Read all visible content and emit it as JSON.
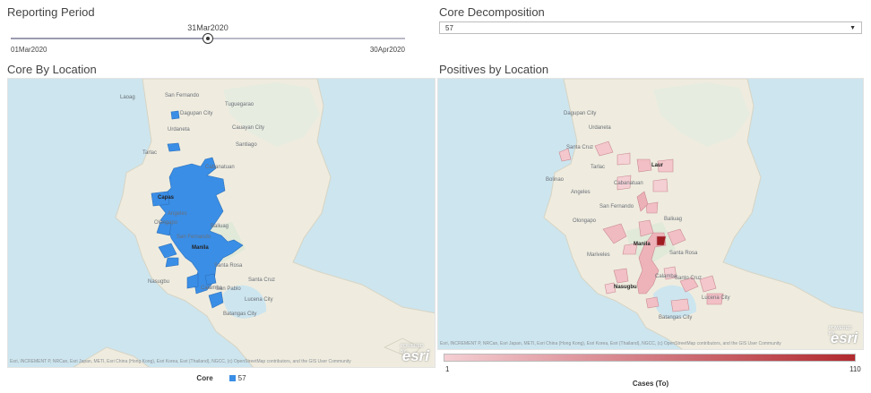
{
  "reporting_period": {
    "title": "Reporting Period",
    "current": "31Mar2020",
    "min": "01Mar2020",
    "max": "30Apr2020",
    "position_fraction": 0.5
  },
  "core_decomposition": {
    "title": "Core Decomposition",
    "selected": "57"
  },
  "left_map": {
    "title": "Core By Location",
    "attribution": "Esri, INCREMENT P, NRCan, Esri Japan, METI, Esri China (Hong Kong), Esri Korea, Esri (Thailand), NGCC, (c) OpenStreetMap contributors, and the GIS User Community",
    "logo": "esri",
    "legend_title": "Core",
    "legend_item": "57",
    "legend_color": "#3a8ee6",
    "place_labels": [
      "San Fernando",
      "Tuguegarao",
      "Laoag",
      "Cauayan City",
      "Dagupan City",
      "Santiago",
      "Urdaneta",
      "Tarlac",
      "Cabanatuan",
      "Capas",
      "Angeles",
      "Baliuag",
      "Olongapo",
      "San Fernando",
      "Manila",
      "Lucena City",
      "Batangas City",
      "Santa Cruz",
      "Calamba",
      "San Pablo",
      "Santa Rosa",
      "Nasugbu"
    ]
  },
  "right_map": {
    "title": "Positives by Location",
    "attribution": "Esri, INCREMENT P, NRCan, Esri Japan, METI, Esri China (Hong Kong), Esri Korea, Esri (Thailand), NGCC, (c) OpenStreetMap contributors, and the GIS User Community",
    "logo": "esri",
    "legend_title": "Cases (To)",
    "legend_min": "1",
    "legend_max": "110",
    "color_low": "#f4cfd3",
    "color_high": "#b12a2f",
    "place_labels": [
      "Dagupan City",
      "Urdaneta",
      "Santa Cruz",
      "Tarlac",
      "Cabanatuan",
      "Laur",
      "Bolinao",
      "Angeles",
      "San Fernando",
      "Baliuag",
      "Olongapo",
      "Manila",
      "Mariveles",
      "Santa Rosa",
      "Santo Cruz",
      "Nasugbu",
      "Calamba",
      "Lucena City",
      "Batangas City"
    ]
  }
}
